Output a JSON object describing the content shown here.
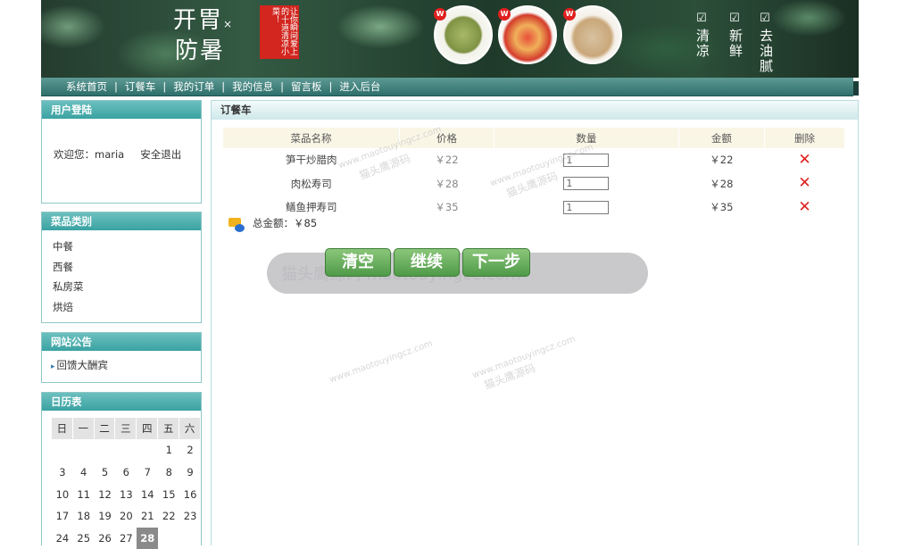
{
  "banner": {
    "title_line1": "开胃",
    "title_mark": "×",
    "title_line2": "防暑",
    "seal_text": "让你瞬间爱上的十道清凉小菜！",
    "badge": "W",
    "tags": [
      "清凉",
      "新鲜",
      "去油腻"
    ]
  },
  "nav": {
    "items": [
      "系统首页",
      "订餐车",
      "我的订单",
      "我的信息",
      "留言板",
      "进入后台"
    ],
    "separator": "|"
  },
  "login": {
    "title": "用户登陆",
    "welcome": "欢迎您：maria",
    "logout": "安全退出"
  },
  "categories": {
    "title": "菜品类别",
    "items": [
      "中餐",
      "西餐",
      "私房菜",
      "烘焙"
    ]
  },
  "notices": {
    "title": "网站公告",
    "items": [
      "回馈大酬宾"
    ]
  },
  "calendar": {
    "title": "日历表",
    "weekdays": [
      "日",
      "一",
      "二",
      "三",
      "四",
      "五",
      "六"
    ],
    "rows": [
      [
        "",
        "",
        "",
        "",
        "",
        "1",
        "2"
      ],
      [
        "3",
        "4",
        "5",
        "6",
        "7",
        "8",
        "9"
      ],
      [
        "10",
        "11",
        "12",
        "13",
        "14",
        "15",
        "16"
      ],
      [
        "17",
        "18",
        "19",
        "20",
        "21",
        "22",
        "23"
      ],
      [
        "24",
        "25",
        "26",
        "27",
        "28",
        "",
        ""
      ]
    ],
    "today": "28"
  },
  "cart": {
    "title": "订餐车",
    "headers": [
      "菜品名称",
      "价格",
      "数量",
      "金额",
      "删除"
    ],
    "rows": [
      {
        "name": "笋干炒腊肉",
        "price": "￥22",
        "qty": "1",
        "amount": "￥22"
      },
      {
        "name": "肉松寿司",
        "price": "￥28",
        "qty": "1",
        "amount": "￥28"
      },
      {
        "name": "鳝鱼押寿司",
        "price": "￥35",
        "qty": "1",
        "amount": "￥35"
      }
    ],
    "delete_icon": "red-x-icon",
    "total_label": "总金额：",
    "total_value": "￥85"
  },
  "actions": {
    "clear": "清空",
    "continue": "继续",
    "next": "下一步"
  },
  "watermark": {
    "url": "www.maotouyingcz.com",
    "name": "猫头鹰源码",
    "big": "猫头鹰源码 maotouyingce.com"
  },
  "colors": {
    "nav_bg": "#2e6f6b",
    "box_head": "#3aa2a2",
    "delete_red": "#e02020",
    "button_green": "#4f9a49"
  }
}
